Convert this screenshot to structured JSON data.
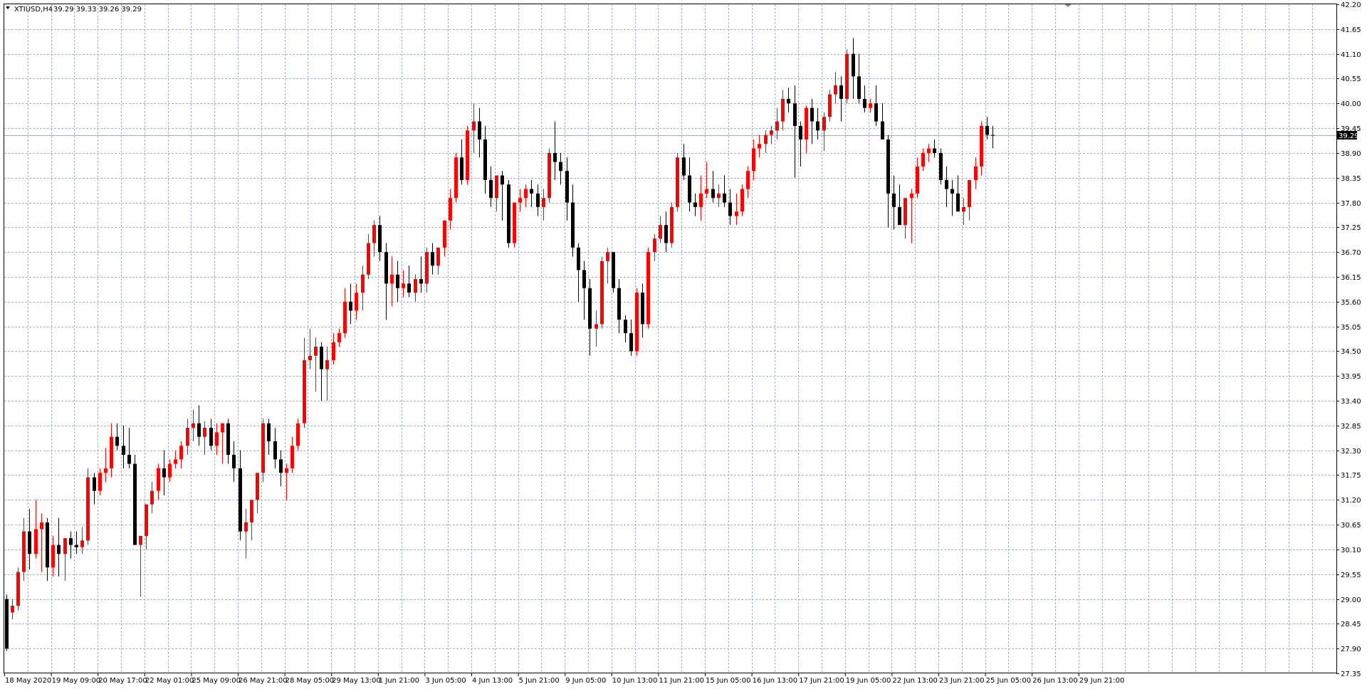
{
  "header": {
    "symbol": "XTIUSD,H4",
    "ohlc": "39.29 39.33 39.26 39.29"
  },
  "current_price_label": "39.29",
  "colors": {
    "bull": "#ff0000",
    "bear": "#000000",
    "grid": "#a9b2c3",
    "price_line": "#a0a8bc",
    "doji": "#00c000"
  },
  "chart_data": {
    "type": "candlestick",
    "title": "",
    "xlabel": "",
    "ylabel": "",
    "grid": true,
    "ylim": [
      27.35,
      42.2
    ],
    "price_axis_ticks": [
      "42.20",
      "41.65",
      "41.10",
      "40.55",
      "40.00",
      "39.45",
      "38.90",
      "38.35",
      "37.80",
      "37.25",
      "36.70",
      "36.15",
      "35.60",
      "35.05",
      "34.50",
      "33.95",
      "33.40",
      "32.85",
      "32.30",
      "31.75",
      "31.20",
      "30.65",
      "30.10",
      "29.55",
      "29.00",
      "28.45",
      "27.90",
      "27.35"
    ],
    "time_axis_labels": [
      "18 May 2020",
      "19 May 09:00",
      "20 May 17:00",
      "22 May 01:00",
      "25 May 09:00",
      "26 May 21:00",
      "28 May 05:00",
      "29 May 13:00",
      "1 Jun 21:00",
      "3 Jun 05:00",
      "4 Jun 13:00",
      "5 Jun 21:00",
      "9 Jun 05:00",
      "10 Jun 13:00",
      "11 Jun 21:00",
      "15 Jun 05:00",
      "16 Jun 13:00",
      "17 Jun 21:00",
      "19 Jun 05:00",
      "22 Jun 13:00",
      "23 Jun 21:00",
      "25 Jun 05:00",
      "26 Jun 13:00",
      "29 Jun 21:00"
    ],
    "last_price": 39.29,
    "ohlc": [
      [
        29.0,
        29.1,
        27.85,
        27.9
      ],
      [
        28.7,
        29.0,
        28.55,
        28.85
      ],
      [
        28.85,
        29.7,
        28.75,
        29.6
      ],
      [
        29.6,
        30.8,
        29.4,
        30.5
      ],
      [
        30.5,
        31.0,
        29.65,
        30.0
      ],
      [
        30.0,
        31.2,
        29.9,
        30.55
      ],
      [
        30.55,
        30.9,
        29.6,
        30.7
      ],
      [
        30.7,
        30.8,
        29.4,
        29.7
      ],
      [
        29.7,
        30.4,
        29.5,
        30.2
      ],
      [
        30.2,
        30.8,
        29.5,
        30.0
      ],
      [
        30.0,
        30.35,
        29.4,
        30.35
      ],
      [
        30.35,
        30.5,
        29.9,
        30.2
      ],
      [
        30.2,
        30.5,
        30.0,
        30.15
      ],
      [
        30.15,
        30.6,
        30.0,
        30.3
      ],
      [
        30.3,
        31.9,
        30.2,
        31.7
      ],
      [
        31.7,
        31.8,
        31.1,
        31.4
      ],
      [
        31.4,
        31.9,
        31.3,
        31.8
      ],
      [
        31.8,
        32.35,
        31.6,
        31.9
      ],
      [
        31.9,
        32.9,
        31.7,
        32.6
      ],
      [
        32.6,
        32.9,
        32.3,
        32.4
      ],
      [
        32.4,
        32.85,
        31.9,
        32.2
      ],
      [
        32.2,
        32.8,
        31.9,
        32.0
      ],
      [
        32.0,
        32.2,
        30.5,
        30.2
      ],
      [
        30.2,
        30.4,
        29.05,
        30.4
      ],
      [
        30.4,
        31.0,
        30.1,
        31.1
      ],
      [
        31.1,
        31.6,
        30.9,
        31.4
      ],
      [
        31.4,
        32.0,
        31.2,
        31.9
      ],
      [
        31.9,
        32.3,
        31.3,
        31.7
      ],
      [
        31.7,
        32.1,
        31.6,
        32.0
      ],
      [
        32.0,
        32.3,
        31.9,
        32.1
      ],
      [
        32.1,
        32.5,
        31.9,
        32.4
      ],
      [
        32.4,
        33.0,
        32.2,
        32.8
      ],
      [
        32.8,
        33.2,
        32.5,
        32.9
      ],
      [
        32.9,
        33.3,
        32.4,
        32.6
      ],
      [
        32.6,
        32.95,
        32.2,
        32.8
      ],
      [
        32.8,
        33.0,
        32.3,
        32.4
      ],
      [
        32.4,
        32.9,
        32.2,
        32.7
      ],
      [
        32.7,
        32.9,
        32.0,
        32.9
      ],
      [
        32.9,
        33.0,
        32.0,
        32.2
      ],
      [
        32.2,
        32.5,
        31.6,
        31.9
      ],
      [
        31.9,
        32.3,
        30.3,
        30.5
      ],
      [
        30.5,
        31.0,
        29.9,
        30.7
      ],
      [
        30.7,
        31.1,
        30.3,
        31.2
      ],
      [
        31.2,
        31.8,
        30.9,
        31.8
      ],
      [
        31.8,
        33.0,
        31.6,
        32.9
      ],
      [
        32.9,
        33.0,
        32.2,
        32.5
      ],
      [
        32.5,
        32.8,
        31.9,
        32.1
      ],
      [
        32.1,
        32.3,
        31.5,
        31.8
      ],
      [
        31.8,
        32.0,
        31.2,
        31.9
      ],
      [
        31.9,
        32.6,
        31.8,
        32.4
      ],
      [
        32.4,
        33.0,
        32.3,
        32.9
      ],
      [
        32.9,
        34.8,
        32.8,
        34.3
      ],
      [
        34.3,
        35.0,
        34.1,
        34.4
      ],
      [
        34.4,
        34.8,
        33.6,
        34.6
      ],
      [
        34.6,
        34.7,
        33.4,
        34.1
      ],
      [
        34.1,
        34.6,
        33.4,
        34.3
      ],
      [
        34.3,
        34.9,
        34.2,
        34.7
      ],
      [
        34.7,
        35.0,
        34.6,
        34.9
      ],
      [
        34.9,
        35.9,
        34.8,
        35.6
      ],
      [
        35.6,
        36.0,
        35.1,
        35.4
      ],
      [
        35.4,
        36.0,
        35.2,
        35.8
      ],
      [
        35.8,
        36.4,
        35.4,
        36.2
      ],
      [
        36.2,
        37.1,
        36.1,
        36.9
      ],
      [
        36.9,
        37.4,
        36.6,
        37.3
      ],
      [
        37.3,
        37.5,
        36.5,
        36.7
      ],
      [
        36.7,
        36.9,
        35.2,
        36.0
      ],
      [
        36.0,
        36.6,
        35.5,
        36.2
      ],
      [
        36.2,
        36.5,
        35.6,
        35.9
      ],
      [
        35.9,
        36.3,
        35.7,
        36.0
      ],
      [
        36.0,
        36.4,
        35.7,
        35.8
      ],
      [
        35.8,
        36.2,
        35.6,
        36.1
      ],
      [
        36.1,
        36.6,
        35.8,
        36.0
      ],
      [
        36.0,
        36.8,
        35.8,
        36.7
      ],
      [
        36.7,
        36.9,
        36.2,
        36.4
      ],
      [
        36.4,
        36.8,
        36.2,
        36.8
      ],
      [
        36.8,
        37.4,
        36.6,
        37.4
      ],
      [
        37.4,
        38.1,
        37.2,
        37.9
      ],
      [
        37.9,
        38.9,
        37.8,
        38.8
      ],
      [
        38.8,
        39.2,
        38.2,
        38.3
      ],
      [
        38.3,
        39.5,
        38.2,
        39.4
      ],
      [
        39.4,
        40.0,
        38.9,
        39.6
      ],
      [
        39.6,
        39.9,
        38.8,
        39.2
      ],
      [
        39.2,
        39.5,
        38.0,
        38.3
      ],
      [
        38.3,
        38.6,
        37.7,
        37.9
      ],
      [
        37.9,
        38.4,
        37.6,
        38.4
      ],
      [
        38.4,
        38.5,
        37.4,
        38.2
      ],
      [
        38.2,
        38.3,
        36.8,
        36.9
      ],
      [
        36.9,
        37.8,
        36.8,
        37.8
      ],
      [
        37.8,
        38.1,
        37.6,
        37.9
      ],
      [
        37.9,
        38.2,
        37.7,
        38.1
      ],
      [
        38.1,
        38.3,
        37.7,
        38.0
      ],
      [
        38.0,
        38.2,
        37.5,
        37.7
      ],
      [
        37.7,
        38.1,
        37.4,
        37.9
      ],
      [
        37.9,
        39.0,
        37.8,
        38.9
      ],
      [
        38.9,
        39.6,
        38.3,
        38.7
      ],
      [
        38.7,
        38.9,
        38.2,
        38.5
      ],
      [
        38.5,
        38.8,
        37.4,
        37.8
      ],
      [
        37.8,
        38.2,
        36.6,
        36.8
      ],
      [
        36.8,
        36.9,
        35.6,
        36.3
      ],
      [
        36.3,
        36.5,
        35.2,
        35.9
      ],
      [
        35.9,
        36.1,
        34.4,
        35.0
      ],
      [
        35.0,
        35.4,
        34.6,
        35.1
      ],
      [
        35.1,
        36.6,
        35.0,
        36.5
      ],
      [
        36.5,
        36.8,
        36.0,
        36.7
      ],
      [
        36.7,
        36.7,
        35.8,
        35.9
      ],
      [
        35.9,
        36.1,
        34.9,
        35.2
      ],
      [
        35.2,
        35.3,
        34.7,
        34.9
      ],
      [
        34.9,
        35.2,
        34.4,
        34.5
      ],
      [
        34.5,
        35.9,
        34.4,
        35.8
      ],
      [
        35.8,
        36.0,
        34.8,
        35.1
      ],
      [
        35.1,
        36.8,
        35.0,
        36.7
      ],
      [
        36.7,
        37.1,
        36.5,
        37.0
      ],
      [
        37.0,
        37.5,
        36.9,
        37.3
      ],
      [
        37.3,
        37.6,
        36.7,
        36.9
      ],
      [
        36.9,
        37.8,
        36.8,
        37.7
      ],
      [
        37.7,
        38.9,
        37.6,
        38.8
      ],
      [
        38.8,
        39.1,
        38.3,
        38.4
      ],
      [
        38.4,
        38.8,
        37.6,
        37.8
      ],
      [
        37.8,
        38.0,
        37.5,
        37.7
      ],
      [
        37.7,
        38.4,
        37.4,
        38.0
      ],
      [
        38.0,
        38.7,
        37.9,
        38.1
      ],
      [
        38.1,
        38.5,
        37.8,
        37.9
      ],
      [
        37.9,
        38.2,
        37.7,
        38.0
      ],
      [
        38.0,
        38.4,
        37.7,
        37.8
      ],
      [
        37.8,
        38.1,
        37.3,
        37.5
      ],
      [
        37.5,
        38.0,
        37.3,
        37.6
      ],
      [
        37.6,
        38.2,
        37.5,
        38.1
      ],
      [
        38.1,
        38.6,
        37.9,
        38.5
      ],
      [
        38.5,
        39.2,
        38.3,
        39.0
      ],
      [
        39.0,
        39.3,
        38.8,
        39.1
      ],
      [
        39.1,
        39.4,
        38.9,
        39.3
      ],
      [
        39.3,
        39.5,
        39.1,
        39.4
      ],
      [
        39.4,
        39.9,
        39.2,
        39.6
      ],
      [
        39.6,
        40.3,
        39.4,
        40.1
      ],
      [
        40.1,
        40.35,
        39.8,
        40.0
      ],
      [
        40.0,
        40.4,
        38.35,
        39.5
      ],
      [
        39.5,
        39.6,
        38.6,
        39.2
      ],
      [
        39.2,
        39.95,
        38.9,
        39.9
      ],
      [
        39.9,
        40.1,
        39.1,
        39.6
      ],
      [
        39.6,
        39.9,
        39.2,
        39.4
      ],
      [
        39.4,
        39.8,
        38.95,
        39.7
      ],
      [
        39.7,
        40.3,
        39.6,
        40.2
      ],
      [
        40.2,
        40.7,
        40.0,
        40.4
      ],
      [
        40.4,
        40.6,
        39.6,
        40.1
      ],
      [
        40.1,
        41.2,
        40.0,
        41.1
      ],
      [
        41.1,
        41.45,
        40.1,
        40.6
      ],
      [
        40.6,
        41.1,
        40.0,
        40.1
      ],
      [
        40.1,
        40.4,
        39.8,
        39.9
      ],
      [
        39.9,
        40.1,
        39.8,
        40.0
      ],
      [
        40.0,
        40.4,
        39.5,
        39.6
      ],
      [
        39.6,
        40.0,
        39.3,
        39.2
      ],
      [
        39.2,
        39.3,
        37.25,
        38.0
      ],
      [
        38.0,
        38.4,
        37.2,
        37.7
      ],
      [
        37.7,
        38.2,
        37.4,
        37.3
      ],
      [
        37.3,
        37.6,
        37.0,
        37.9
      ],
      [
        37.9,
        38.1,
        36.9,
        38.0
      ],
      [
        38.0,
        38.8,
        37.9,
        38.6
      ],
      [
        38.6,
        39.0,
        38.5,
        38.9
      ],
      [
        38.9,
        39.1,
        38.7,
        39.0
      ],
      [
        39.0,
        39.2,
        38.8,
        38.9
      ],
      [
        38.9,
        39.0,
        38.2,
        38.3
      ],
      [
        38.3,
        38.6,
        37.7,
        38.1
      ],
      [
        38.1,
        38.3,
        37.5,
        38.0
      ],
      [
        38.0,
        38.4,
        37.6,
        37.6
      ],
      [
        37.6,
        37.9,
        37.3,
        37.7
      ],
      [
        37.7,
        38.3,
        37.4,
        38.3
      ],
      [
        38.3,
        38.8,
        38.1,
        38.6
      ],
      [
        38.6,
        39.6,
        38.4,
        39.5
      ],
      [
        39.5,
        39.7,
        39.2,
        39.3
      ],
      [
        39.3,
        39.5,
        39.0,
        39.29
      ]
    ]
  }
}
